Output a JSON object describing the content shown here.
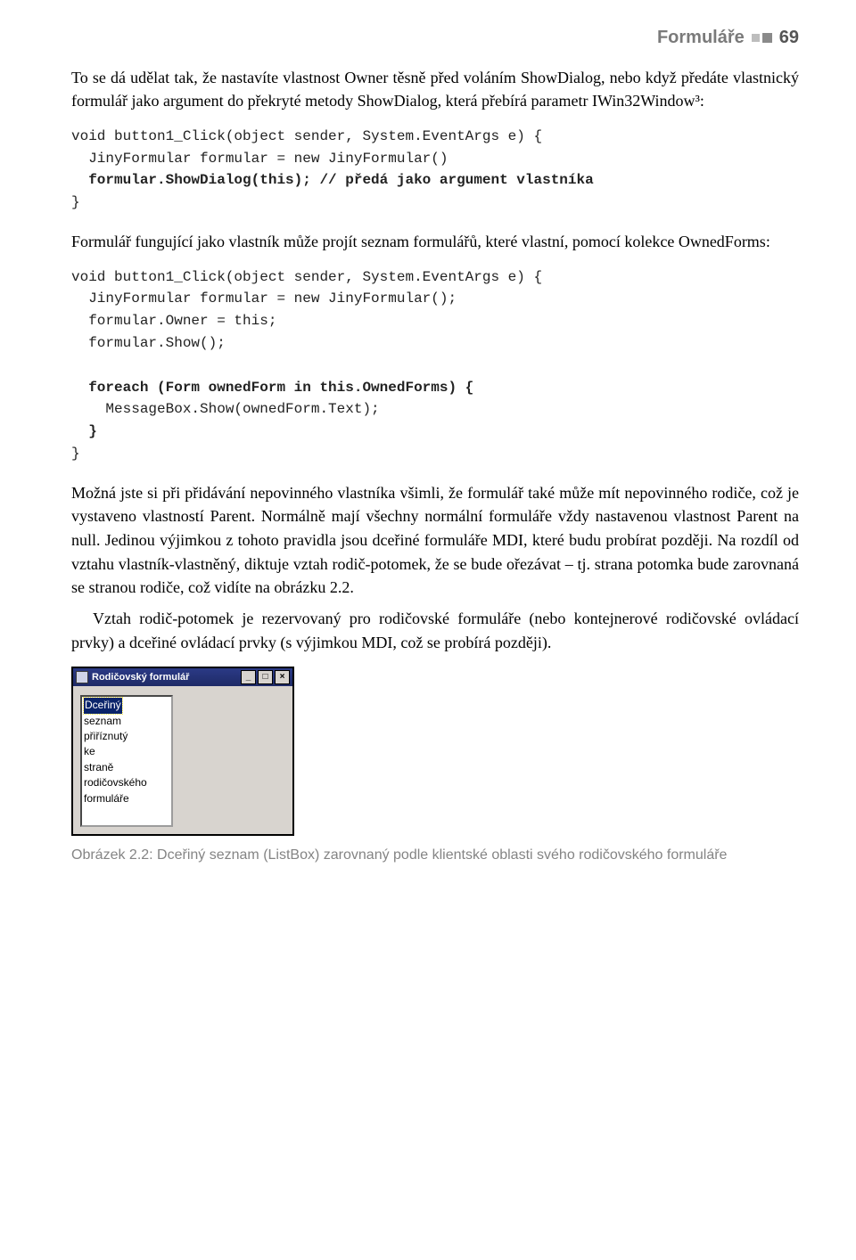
{
  "header": {
    "chapter": "Formuláře",
    "page": "69"
  },
  "para1": "To se dá udělat tak, že nastavíte vlastnost Owner těsně před voláním ShowDialog, nebo když předáte vlastnický formulář jako argument do překryté metody ShowDialog, která přebírá parametr IWin32Window³:",
  "code1": {
    "l1": "void button1_Click(object sender, System.EventArgs e) {",
    "l2": "  JinyFormular formular = new JinyFormular()",
    "l3a": "  ",
    "l3b": "formular.ShowDialog(this); // předá jako argument vlastníka",
    "l4": "}"
  },
  "para2": "Formulář fungující jako vlastník může projít seznam formulářů, které vlastní, pomocí kolekce OwnedForms:",
  "code2": {
    "l1": "void button1_Click(object sender, System.EventArgs e) {",
    "l2": "  JinyFormular formular = new JinyFormular();",
    "l3": "  formular.Owner = this;",
    "l4": "  formular.Show();",
    "blank1": "",
    "l5a": "  ",
    "l5b": "foreach (Form ownedForm in this.OwnedForms) {",
    "l6": "    MessageBox.Show(ownedForm.Text);",
    "l7a": "  ",
    "l7b": "}",
    "l8": "}"
  },
  "para3": "Možná jste si při přidávání nepovinného vlastníka všimli, že formulář také může mít nepovinného rodiče, což je vystaveno vlastností Parent. Normálně mají všechny normální formuláře vždy nastavenou vlastnost Parent na null. Jedinou výjimkou z tohoto pravidla jsou dceřiné formuláře MDI, které budu probírat později. Na rozdíl od vztahu vlastník-vlastněný, diktuje vztah rodič-potomek, že se bude ořezávat – tj. strana potomka bude zarovnaná se stranou rodiče, což vidíte na obrázku 2.2.",
  "para4": "Vztah rodič-potomek je rezervovaný pro rodičovské formuláře (nebo kontejnerové rodičovské ovládací prvky) a dceřiné ovládací prvky (s výjimkou MDI, což se probírá později).",
  "window": {
    "title": "Rodičovský formulář",
    "min": "_",
    "max": "□",
    "close": "×",
    "list_selected": "Dceřiný",
    "list_items": [
      "seznam",
      "přiříznutý",
      "ke",
      "straně",
      "rodičovského",
      "formuláře"
    ]
  },
  "caption": "Obrázek 2.2: Dceřiný seznam (ListBox) zarovnaný podle klientské oblasti svého rodičovského formuláře"
}
